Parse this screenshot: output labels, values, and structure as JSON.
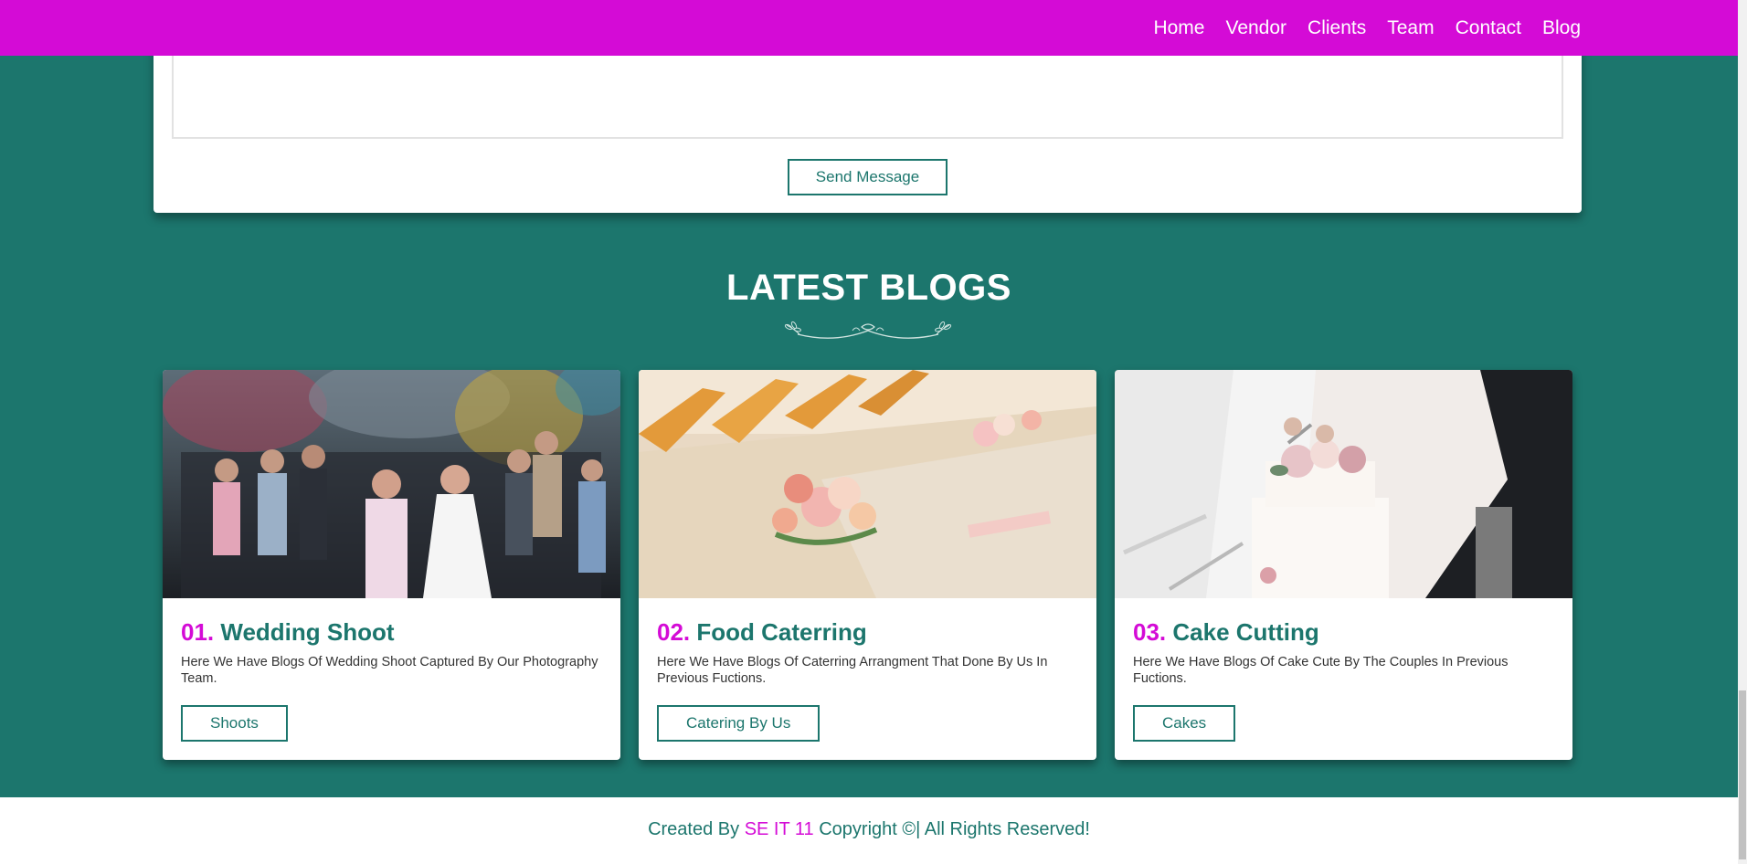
{
  "nav": {
    "links": [
      "Home",
      "Vendor",
      "Clients",
      "Team",
      "Contact",
      "Blog"
    ]
  },
  "contact": {
    "send_label": "Send Message"
  },
  "blogs": {
    "title": "LATEST BLOGS",
    "cards": [
      {
        "num": "01.",
        "title": "Wedding Shoot",
        "desc": "Here We Have Blogs Of Wedding Shoot Captured By Our Photography Team.",
        "button": "Shoots"
      },
      {
        "num": "02.",
        "title": "Food Caterring",
        "desc": "Here We Have Blogs Of Caterring Arrangment That Done By Us In Previous Fuctions.",
        "button": "Catering By Us"
      },
      {
        "num": "03.",
        "title": "Cake Cutting",
        "desc": "Here We Have Blogs Of Cake Cute By The Couples In Previous Fuctions.",
        "button": "Cakes"
      }
    ]
  },
  "footer": {
    "prefix": "Created By",
    "brand": "SE IT 11",
    "suffix": "Copyright ©| All Rights Reserved!"
  },
  "colors": {
    "primary": "#1c766d",
    "accent": "#d40bd6",
    "surface": "#ffffff"
  }
}
